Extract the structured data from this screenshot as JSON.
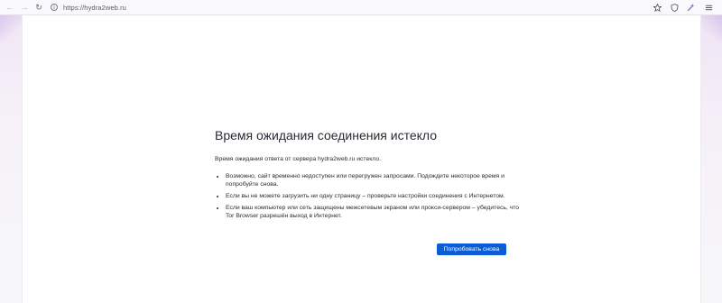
{
  "browser": {
    "url": "https://hydra2web.ru",
    "nav": {
      "back_icon": "arrow-left-icon",
      "forward_icon": "arrow-right-icon",
      "reload_icon": "reload-icon"
    },
    "toolbar_icons": [
      "bookmark-star-icon",
      "shield-icon",
      "extension-icon",
      "menu-icon"
    ]
  },
  "error_page": {
    "title": "Время ожидания соединения истекло",
    "lead": "Время ожидания ответа от сервера hydra2web.ru истекло.",
    "bullets": [
      "Возможно, сайт временно недоступен или перегружен запросами. Подождите некоторое время и попробуйте снова.",
      "Если вы не можете загрузить ни одну страницу – проверьте настройки соединения с Интернетом.",
      "Если ваш компьютер или сеть защищены межсетевым экраном или прокси-сервером – убедитесь, что Tor Browser разрешён выход в Интернет."
    ],
    "retry_label": "Попробовать снова"
  },
  "colors": {
    "accent": "#0b5cd5",
    "text": "#2b2a33",
    "toolbar_bg": "#f9f9fb"
  }
}
